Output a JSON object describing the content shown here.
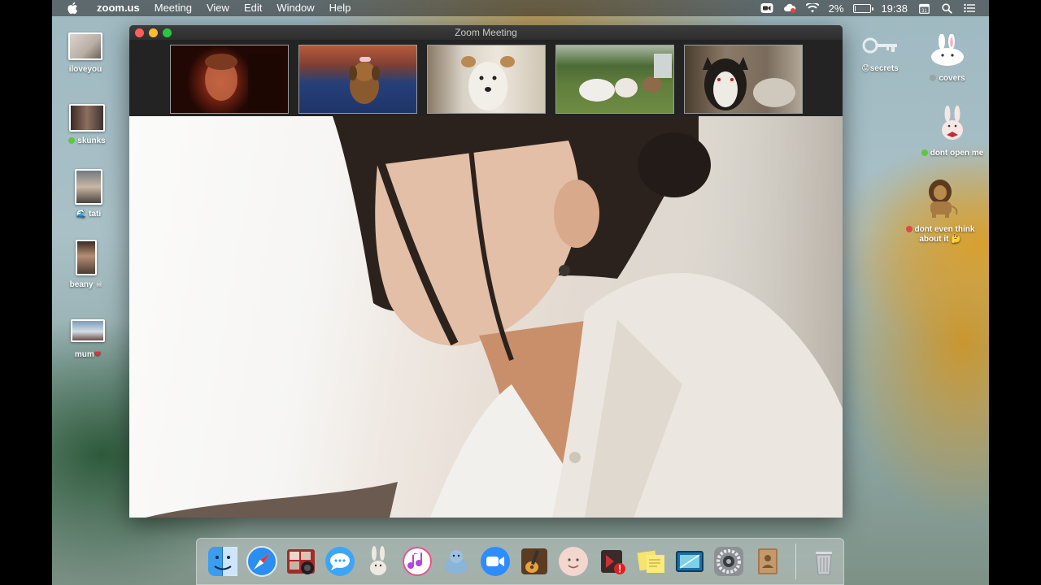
{
  "menubar": {
    "app_name": "zoom.us",
    "menus": [
      "Meeting",
      "View",
      "Edit",
      "Window",
      "Help"
    ],
    "battery_percent": "2%",
    "battery_level": 0.02,
    "time": "19:38"
  },
  "desktop_left": [
    {
      "label": "iloveyou",
      "dot": ""
    },
    {
      "label": "skunks",
      "dot": "#5cc93b"
    },
    {
      "label": "tati",
      "dot": ""
    },
    {
      "label": "beany",
      "dot": ""
    },
    {
      "label": "mum",
      "dot": ""
    }
  ],
  "desktop_right": [
    {
      "label": "secrets",
      "dot": ""
    },
    {
      "label": "covers",
      "dot": "#9aa4a6"
    },
    {
      "label": "dont open me",
      "dot": "#5cc93b"
    },
    {
      "label": "dont even think about it",
      "dot": "#e04848"
    }
  ],
  "zoom": {
    "window_title": "Zoom Meeting",
    "participants": [
      "participant-1",
      "participant-2",
      "participant-3",
      "participant-4",
      "participant-5"
    ]
  },
  "dock": {
    "apps": [
      "finder",
      "safari",
      "photo-booth",
      "messages",
      "launchpad",
      "itunes",
      "preview",
      "zoom",
      "garageband",
      "memoji",
      "photo-booth-alt",
      "stickies",
      "screen-sharing",
      "system-preferences",
      "contacts",
      "trash"
    ]
  },
  "colors": {
    "close": "#fc5f57",
    "minimize": "#fdbc2e",
    "maximize": "#28c840"
  }
}
